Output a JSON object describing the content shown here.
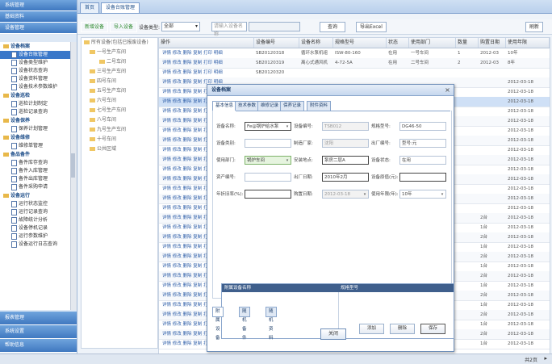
{
  "sidebar": {
    "sections_top": [
      "系统管理",
      "基础资料",
      "设备管理"
    ],
    "sections_bottom": [
      "报表管理",
      "系统设置",
      "帮助信息"
    ],
    "groups": [
      {
        "label": "设备档案",
        "items": [
          "设备台账管理",
          "设备类型维护",
          "设备状态查询",
          "设备资料管理",
          "设备技术参数维护"
        ]
      },
      {
        "label": "设备巡检",
        "items": [
          "巡检计划制定",
          "巡检记录查询"
        ]
      },
      {
        "label": "设备保养",
        "items": [
          "保养计划管理"
        ]
      },
      {
        "label": "设备维修",
        "items": [
          "维修单管理"
        ]
      },
      {
        "label": "备品备件",
        "items": [
          "备件库存查询",
          "备件入库管理",
          "备件出库管理",
          "备件采购申请"
        ]
      },
      {
        "label": "设备运行",
        "items": [
          "运行状态监控",
          "运行记录查询",
          "故障统计分析",
          "设备停机记录",
          "运行参数维护",
          "设备运行日志查询"
        ]
      }
    ],
    "selected_item": "设备台账管理"
  },
  "tabbar": {
    "tabs": [
      "首页",
      "设备台账管理"
    ]
  },
  "toolbar": {
    "add_label": "新增设备",
    "import_label": "导入设备",
    "filter_label": "设备类型:",
    "filter_value": "全部",
    "keyword_placeholder": "请输入设备名称",
    "search_label": "查询",
    "export_label": "导出Excel",
    "refresh_label": "刷新"
  },
  "tree": {
    "root": "所有设备(包括已报废设备)",
    "nodes": [
      "一号生产车间",
      "二号车间",
      "三号生产车间",
      "四号车间",
      "五号生产车间",
      "六号车间",
      "七号生产车间",
      "八号车间",
      "九号生产车间",
      "十号车间",
      "公共区域"
    ]
  },
  "grid": {
    "columns": [
      "操作",
      "设备编号",
      "设备名称",
      "规格型号",
      "状态",
      "使用部门",
      "数量",
      "购置日期",
      "使用年限"
    ],
    "action_text": "详情 修改 删除 复制 打印 明细",
    "rows": [
      [
        "SB20120318",
        "循环水泵机组",
        "ISW-80-160",
        "在用",
        "一号车间",
        "1",
        "2012-03",
        "10年"
      ],
      [
        "SB20120319",
        "离心式通风机",
        "4-72-5A",
        "在用",
        "二号车间",
        "2",
        "2012-03",
        "8年"
      ],
      [
        "SB20120320",
        "",
        "",
        "",
        "",
        "",
        "",
        ""
      ]
    ],
    "extra_date": "2012-03-18",
    "extra_values": [
      "1台",
      "2台"
    ]
  },
  "dialog": {
    "title": "设备档案",
    "tabs": [
      "基本信息",
      "技术参数",
      "维修记录",
      "保养记录",
      "附件资料"
    ],
    "fields": [
      {
        "label": "设备名称:",
        "value": "Fe@锅炉给水泵",
        "style": "dark",
        "dropdown": true
      },
      {
        "label": "设备编号:",
        "value": "TSB012",
        "style": "ro"
      },
      {
        "label": "规格型号:",
        "value": "DG46-50",
        "style": "normal"
      },
      {
        "label": "设备类别:",
        "value": "",
        "style": "normal"
      },
      {
        "label": "制造厂家:",
        "value": "沈阳",
        "style": "ro"
      },
      {
        "label": "出厂编号:",
        "value": "型号:元",
        "style": "normal"
      },
      {
        "label": "使用部门:",
        "value": "锅炉车间",
        "style": "green",
        "dropdown": true
      },
      {
        "label": "安装地点:",
        "value": "泵房二层A",
        "style": "dark"
      },
      {
        "label": "设备状态:",
        "value": "在用",
        "style": "normal"
      },
      {
        "label": "资产编号:",
        "value": "",
        "style": "normal"
      },
      {
        "label": "出厂日期:",
        "value": "2010年2月",
        "style": "dark"
      },
      {
        "label": "设备原值(元):",
        "value": "",
        "style": "dark"
      },
      {
        "label": "年折旧率(%):",
        "value": "",
        "style": "dark"
      },
      {
        "label": "购置日期:",
        "value": "2012-03-18",
        "style": "ro",
        "dropdown": true
      },
      {
        "label": "使用年限(年):",
        "value": "10年",
        "style": "normal",
        "dropdown": true
      }
    ],
    "sub_tabs": [
      "附属设备",
      "随机备件",
      "随机资料"
    ],
    "sub_buttons": [
      "添加",
      "删除",
      "保存"
    ],
    "sub_columns": [
      "附属设备名称",
      "规格型号"
    ],
    "ok_label": "关闭"
  },
  "statusbar": {
    "page_label": "共2页",
    "arrow": "▸"
  }
}
